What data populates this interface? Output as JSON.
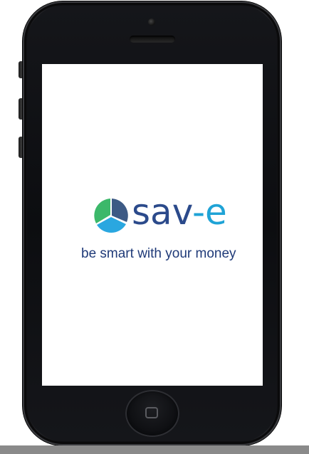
{
  "app": {
    "brand_part1": "sav",
    "brand_part2": "-e",
    "tagline": "be smart with your money"
  },
  "logo": {
    "icon": "pie-logo-icon",
    "colors": {
      "segment_top": "#3d5a85",
      "segment_left": "#3cb86a",
      "segment_bottom": "#2aa7e0"
    }
  },
  "device": {
    "type": "phone",
    "color": "#101114"
  },
  "colors": {
    "brand_dark_blue": "#2b4a8b",
    "brand_light_blue": "#1fa3d6",
    "tagline_blue": "#1f3a78"
  }
}
